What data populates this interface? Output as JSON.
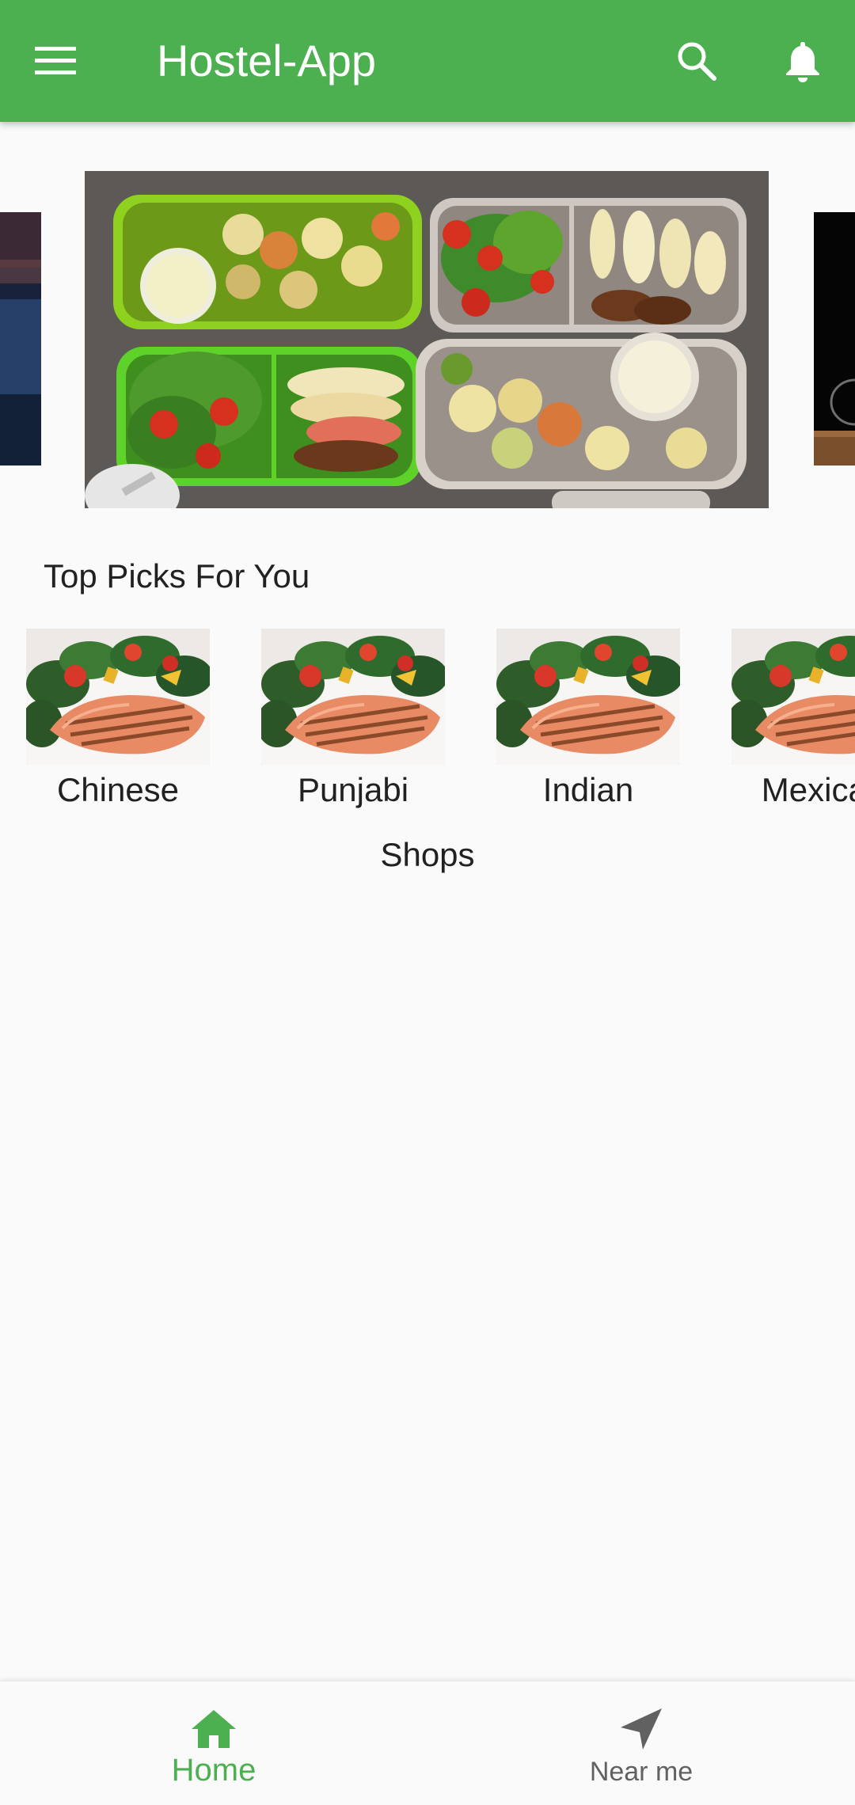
{
  "app_bar": {
    "title": "Hostel-App",
    "background_color": "#4caf50",
    "menu_icon": "menu-icon",
    "search_icon": "search-icon",
    "notification_icon": "bell-icon"
  },
  "carousel": {
    "slides": [
      "lake-at-dusk-photo",
      "lunch-boxes-photo",
      "dark-tabletop-photo"
    ],
    "active_slide": 2
  },
  "top_picks": {
    "heading": "Top Picks For You",
    "items": [
      {
        "label": "Chinese",
        "image": "grilled-salmon-salad-photo"
      },
      {
        "label": "Punjabi",
        "image": "grilled-salmon-salad-photo"
      },
      {
        "label": "Indian",
        "image": "grilled-salmon-salad-photo"
      },
      {
        "label": "Mexican",
        "image": "grilled-salmon-salad-photo"
      }
    ]
  },
  "shops": {
    "heading": "Shops"
  },
  "bottom_nav": {
    "items": [
      {
        "label": "Home",
        "icon": "home-icon",
        "active": true,
        "color": "#4caf50"
      },
      {
        "label": "Near me",
        "icon": "navigation-arrow-icon",
        "active": false,
        "color": "#616161"
      }
    ]
  }
}
